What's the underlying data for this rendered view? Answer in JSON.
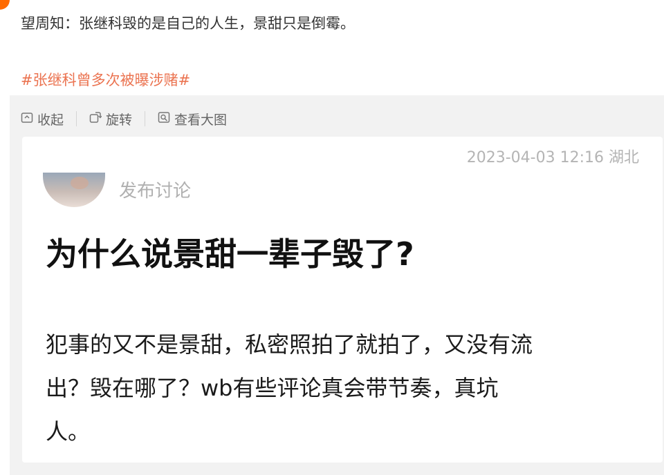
{
  "post": {
    "text": "望周知：张继科毁的是自己的人生，景甜只是倒霉。",
    "hashtag": "#张继科曾多次被曝涉赌#"
  },
  "toolbar": {
    "collapse_label": "收起",
    "rotate_label": "旋转",
    "view_large_label": "查看大图",
    "icons": [
      "collapse-icon",
      "rotate-icon",
      "view-large-icon"
    ]
  },
  "screenshot_card": {
    "timestamp": "2023-04-03 12:16 湖北",
    "author_label": "发布讨论",
    "title": "为什么说景甜一辈子毁了?",
    "body_lines": [
      "犯事的又不是景甜，私密照拍了就拍了，又没有流",
      "出？毁在哪了？wb有些评论真会带节奏，真坑",
      "人。"
    ]
  },
  "colors": {
    "hashtag": "#eb7350",
    "panel_bg": "#f2f2f2",
    "accent_dot": "#ff6a00"
  }
}
